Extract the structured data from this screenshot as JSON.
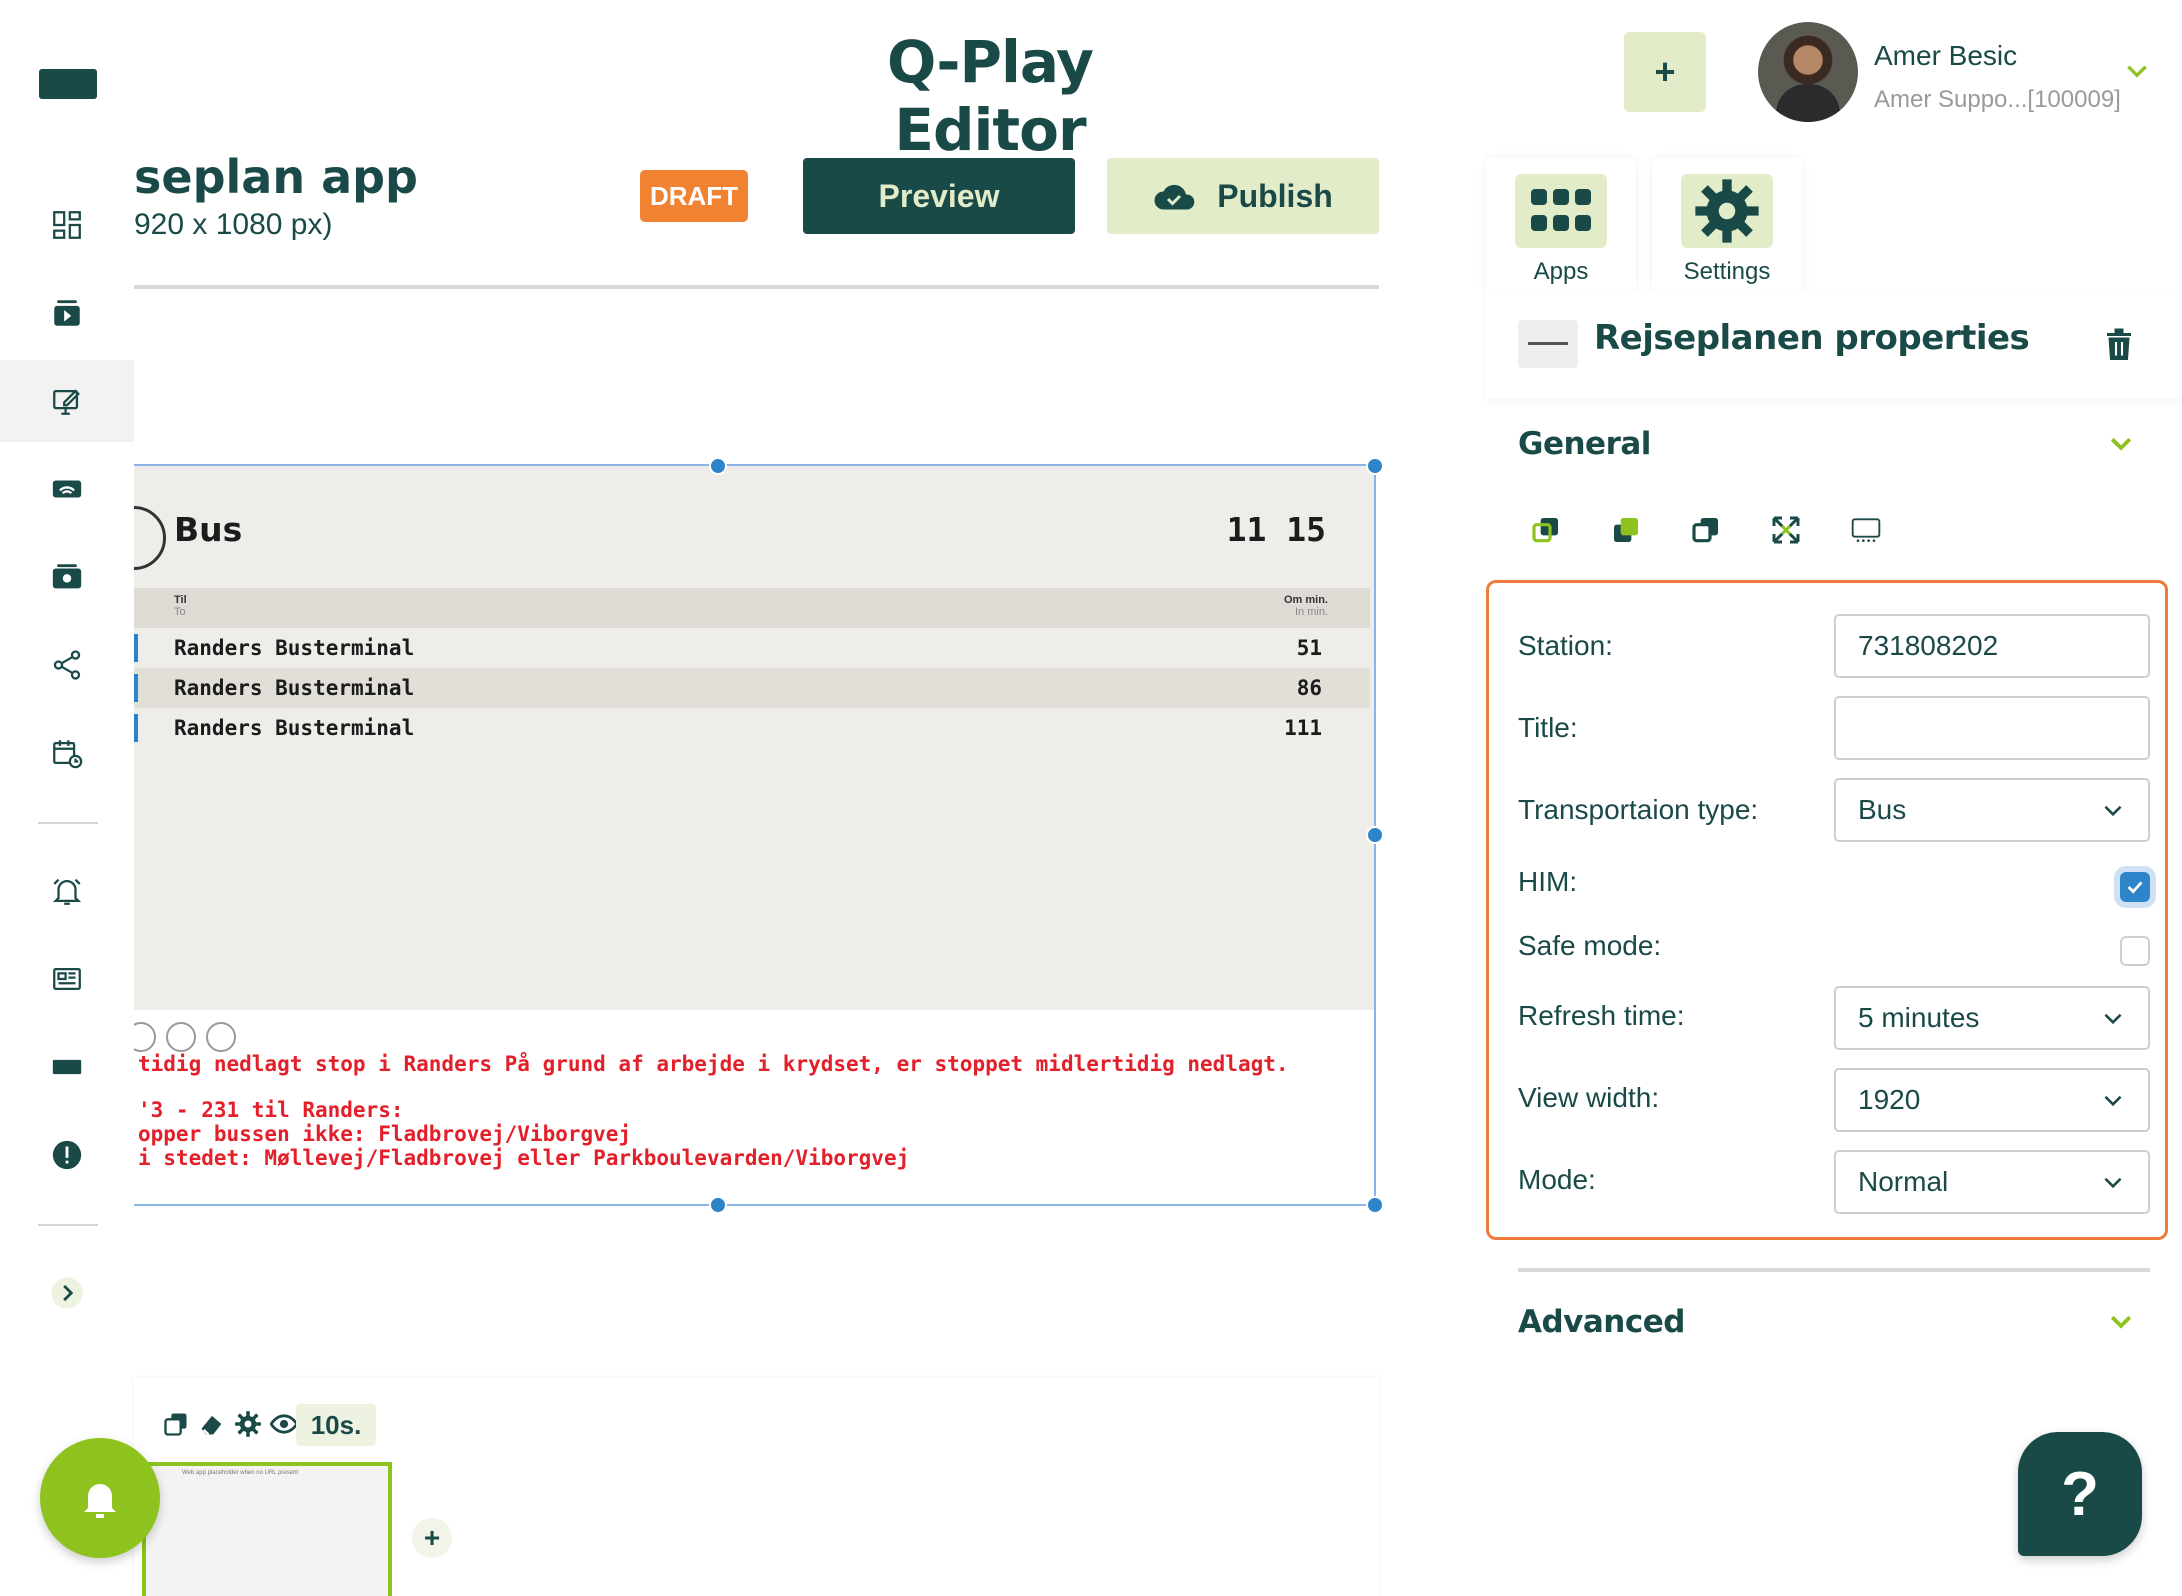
{
  "header": {
    "app_title": "Q-Play Editor",
    "add_label": "+",
    "user": {
      "name": "Amer Besic",
      "subtitle": "Amer Suppo...[100009]"
    }
  },
  "editor": {
    "title": "seplan app",
    "subtitle": "920 x 1080 px)",
    "status_badge": "DRAFT",
    "preview_label": "Preview",
    "publish_label": "Publish"
  },
  "canvas": {
    "transport_label": "Bus",
    "clock": "11 15",
    "col_to": "Til",
    "col_to_en": "To",
    "col_min": "Om min.",
    "col_min_en": "In min.",
    "departures": [
      {
        "destination": "Randers Busterminal",
        "minutes": "51"
      },
      {
        "destination": "Randers Busterminal",
        "minutes": "86"
      },
      {
        "destination": "Randers Busterminal",
        "minutes": "111"
      }
    ],
    "messages": [
      "tidig nedlagt stop i Randers På grund af arbejde i krydset, er stoppet midlertidig nedlagt.",
      "'3 - 231 til Randers:",
      "opper bussen ikke: Fladbrovej/Viborgvej",
      "i stedet: Møllevej/Fladbrovej eller Parkboulevarden/Viborgvej"
    ]
  },
  "timeline": {
    "duration": "10s.",
    "thumb_caption": "Web app placeholder when no URL present",
    "add_label": "+"
  },
  "panel": {
    "tabs": [
      {
        "label": "Apps",
        "icon": "apps-grid-icon"
      },
      {
        "label": "Settings",
        "icon": "gear-icon"
      }
    ],
    "properties_title": "Rejseplanen properties",
    "general_title": "General",
    "advanced_title": "Advanced",
    "fields": {
      "station_label": "Station:",
      "station_value": "731808202",
      "title_label": "Title:",
      "title_value": "",
      "transport_label": "Transportaion type:",
      "transport_value": "Bus",
      "him_label": "HIM:",
      "him_checked": true,
      "safe_label": "Safe mode:",
      "safe_checked": false,
      "refresh_label": "Refresh time:",
      "refresh_value": "5 minutes",
      "width_label": "View width:",
      "width_value": "1920",
      "mode_label": "Mode:",
      "mode_value": "Normal"
    },
    "help_label": "?"
  },
  "colors": {
    "brand_dark": "#1a4a48",
    "brand_light": "#e3ecc9",
    "accent_green": "#8dc21f",
    "draft_orange": "#f08232",
    "highlight_border": "#f07a3c",
    "selection_blue": "#2d84c8",
    "alert_red": "#e3202a"
  }
}
